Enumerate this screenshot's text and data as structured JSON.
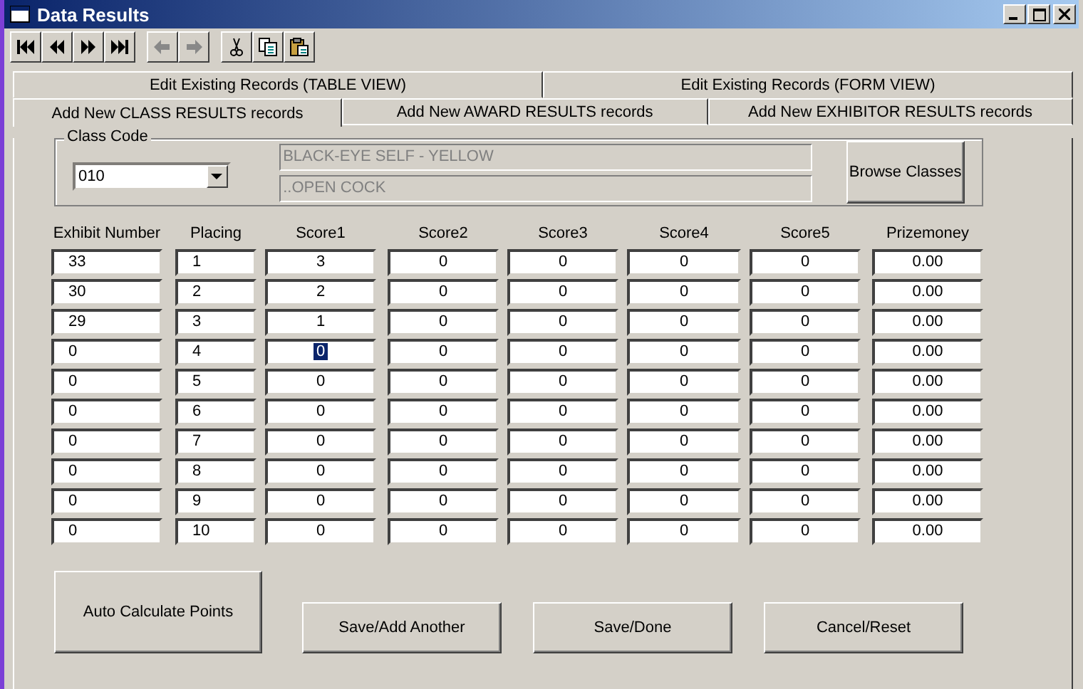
{
  "window": {
    "title": "Data Results"
  },
  "tab_rows": [
    [
      {
        "label": "Edit Existing Records (TABLE VIEW)",
        "selected": false
      },
      {
        "label": "Edit Existing Records (FORM VIEW)",
        "selected": false
      }
    ],
    [
      {
        "label": "Add New CLASS RESULTS records",
        "selected": true
      },
      {
        "label": "Add New AWARD RESULTS records",
        "selected": false
      },
      {
        "label": "Add New EXHIBITOR RESULTS records",
        "selected": false
      }
    ]
  ],
  "class_code": {
    "label": "Class Code",
    "value": "010",
    "description": "BLACK-EYE SELF - YELLOW",
    "section": "..OPEN COCK",
    "browse_button": "Browse Classes"
  },
  "columns": [
    "Exhibit Number",
    "Placing",
    "Score1",
    "Score2",
    "Score3",
    "Score4",
    "Score5",
    "Prizemoney"
  ],
  "rows": [
    [
      {
        "value": "33",
        "focused": false
      },
      {
        "value": "1",
        "focused": false
      },
      {
        "value": "3",
        "focused": false
      },
      {
        "value": "0",
        "focused": false
      },
      {
        "value": "0",
        "focused": false
      },
      {
        "value": "0",
        "focused": false
      },
      {
        "value": "0",
        "focused": false
      },
      {
        "value": "0.00",
        "focused": false
      }
    ],
    [
      {
        "value": "30",
        "focused": false
      },
      {
        "value": "2",
        "focused": false
      },
      {
        "value": "2",
        "focused": false
      },
      {
        "value": "0",
        "focused": false
      },
      {
        "value": "0",
        "focused": false
      },
      {
        "value": "0",
        "focused": false
      },
      {
        "value": "0",
        "focused": false
      },
      {
        "value": "0.00",
        "focused": false
      }
    ],
    [
      {
        "value": "29",
        "focused": false
      },
      {
        "value": "3",
        "focused": false
      },
      {
        "value": "1",
        "focused": false
      },
      {
        "value": "0",
        "focused": false
      },
      {
        "value": "0",
        "focused": false
      },
      {
        "value": "0",
        "focused": false
      },
      {
        "value": "0",
        "focused": false
      },
      {
        "value": "0.00",
        "focused": false
      }
    ],
    [
      {
        "value": "0",
        "focused": false
      },
      {
        "value": "4",
        "focused": false
      },
      {
        "value": "0",
        "focused": true
      },
      {
        "value": "0",
        "focused": false
      },
      {
        "value": "0",
        "focused": false
      },
      {
        "value": "0",
        "focused": false
      },
      {
        "value": "0",
        "focused": false
      },
      {
        "value": "0.00",
        "focused": false
      }
    ],
    [
      {
        "value": "0",
        "focused": false
      },
      {
        "value": "5",
        "focused": false
      },
      {
        "value": "0",
        "focused": false
      },
      {
        "value": "0",
        "focused": false
      },
      {
        "value": "0",
        "focused": false
      },
      {
        "value": "0",
        "focused": false
      },
      {
        "value": "0",
        "focused": false
      },
      {
        "value": "0.00",
        "focused": false
      }
    ],
    [
      {
        "value": "0",
        "focused": false
      },
      {
        "value": "6",
        "focused": false
      },
      {
        "value": "0",
        "focused": false
      },
      {
        "value": "0",
        "focused": false
      },
      {
        "value": "0",
        "focused": false
      },
      {
        "value": "0",
        "focused": false
      },
      {
        "value": "0",
        "focused": false
      },
      {
        "value": "0.00",
        "focused": false
      }
    ],
    [
      {
        "value": "0",
        "focused": false
      },
      {
        "value": "7",
        "focused": false
      },
      {
        "value": "0",
        "focused": false
      },
      {
        "value": "0",
        "focused": false
      },
      {
        "value": "0",
        "focused": false
      },
      {
        "value": "0",
        "focused": false
      },
      {
        "value": "0",
        "focused": false
      },
      {
        "value": "0.00",
        "focused": false
      }
    ],
    [
      {
        "value": "0",
        "focused": false
      },
      {
        "value": "8",
        "focused": false
      },
      {
        "value": "0",
        "focused": false
      },
      {
        "value": "0",
        "focused": false
      },
      {
        "value": "0",
        "focused": false
      },
      {
        "value": "0",
        "focused": false
      },
      {
        "value": "0",
        "focused": false
      },
      {
        "value": "0.00",
        "focused": false
      }
    ],
    [
      {
        "value": "0",
        "focused": false
      },
      {
        "value": "9",
        "focused": false
      },
      {
        "value": "0",
        "focused": false
      },
      {
        "value": "0",
        "focused": false
      },
      {
        "value": "0",
        "focused": false
      },
      {
        "value": "0",
        "focused": false
      },
      {
        "value": "0",
        "focused": false
      },
      {
        "value": "0.00",
        "focused": false
      }
    ],
    [
      {
        "value": "0",
        "focused": false
      },
      {
        "value": "10",
        "focused": false
      },
      {
        "value": "0",
        "focused": false
      },
      {
        "value": "0",
        "focused": false
      },
      {
        "value": "0",
        "focused": false
      },
      {
        "value": "0",
        "focused": false
      },
      {
        "value": "0",
        "focused": false
      },
      {
        "value": "0.00",
        "focused": false
      }
    ]
  ],
  "auto_button": "Auto Calculate Points",
  "buttons": [
    "Save/Add Another",
    "Save/Done",
    "Cancel/Reset"
  ]
}
